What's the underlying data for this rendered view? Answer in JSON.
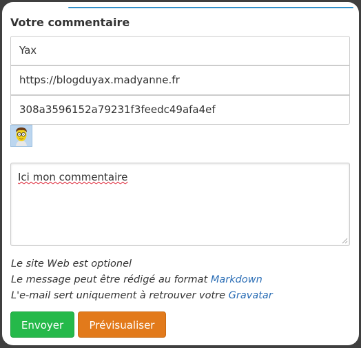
{
  "form": {
    "title": "Votre commentaire",
    "name_value": "Yax",
    "website_value": "https://blogduyax.madyanne.fr",
    "email_value": "308a3596152a79231f3feedc49afa4ef",
    "comment_value": "Ici mon commentaire",
    "avatar_icon": "gravatar-avatar-icon"
  },
  "help": {
    "line1": "Le site Web est optionel",
    "line2_prefix": "Le message peut être rédigé au format ",
    "line2_link": "Markdown",
    "line3_prefix": "L'e-mail sert uniquement à retrouver votre ",
    "line3_link": "Gravatar"
  },
  "buttons": {
    "send_label": "Envoyer",
    "preview_label": "Prévisualiser"
  },
  "colors": {
    "send": "#25b94a",
    "preview": "#e27a1b",
    "link": "#2a6db5",
    "accent": "#2f8fc9"
  }
}
